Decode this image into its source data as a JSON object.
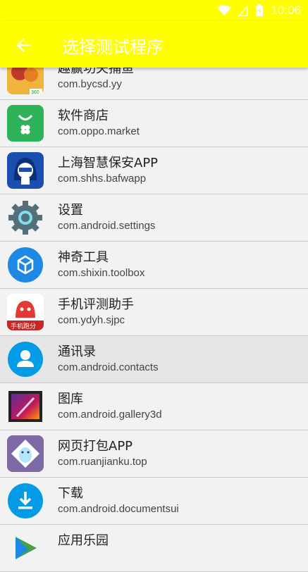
{
  "status": {
    "time": "10:06"
  },
  "appbar": {
    "title": "选择测试程序"
  },
  "apps": [
    {
      "name": "趣赢功夫捕鱼",
      "package": "com.bycsd.yy",
      "icon": "fishing-game-icon"
    },
    {
      "name": "软件商店",
      "package": "com.oppo.market",
      "icon": "oppo-market-icon"
    },
    {
      "name": "上海智慧保安APP",
      "package": "com.shhs.bafwapp",
      "icon": "security-guard-icon"
    },
    {
      "name": "设置",
      "package": "com.android.settings",
      "icon": "gear-icon"
    },
    {
      "name": "神奇工具",
      "package": "com.shixin.toolbox",
      "icon": "toolbox-icon"
    },
    {
      "name": "手机评测助手",
      "package": "com.ydyh.sjpc",
      "icon": "phone-benchmark-icon"
    },
    {
      "name": "通讯录",
      "package": "com.android.contacts",
      "icon": "contacts-icon"
    },
    {
      "name": "图库",
      "package": "com.android.gallery3d",
      "icon": "gallery-icon"
    },
    {
      "name": "网页打包APP",
      "package": "com.ruanjianku.top",
      "icon": "web-package-icon"
    },
    {
      "name": "下载",
      "package": "com.android.documentsui",
      "icon": "download-icon"
    },
    {
      "name": "应用乐园",
      "package": "",
      "icon": "play-icon"
    }
  ],
  "badge": {
    "bottom_text": "360"
  },
  "phone_badge": {
    "text": "手机跑分"
  }
}
